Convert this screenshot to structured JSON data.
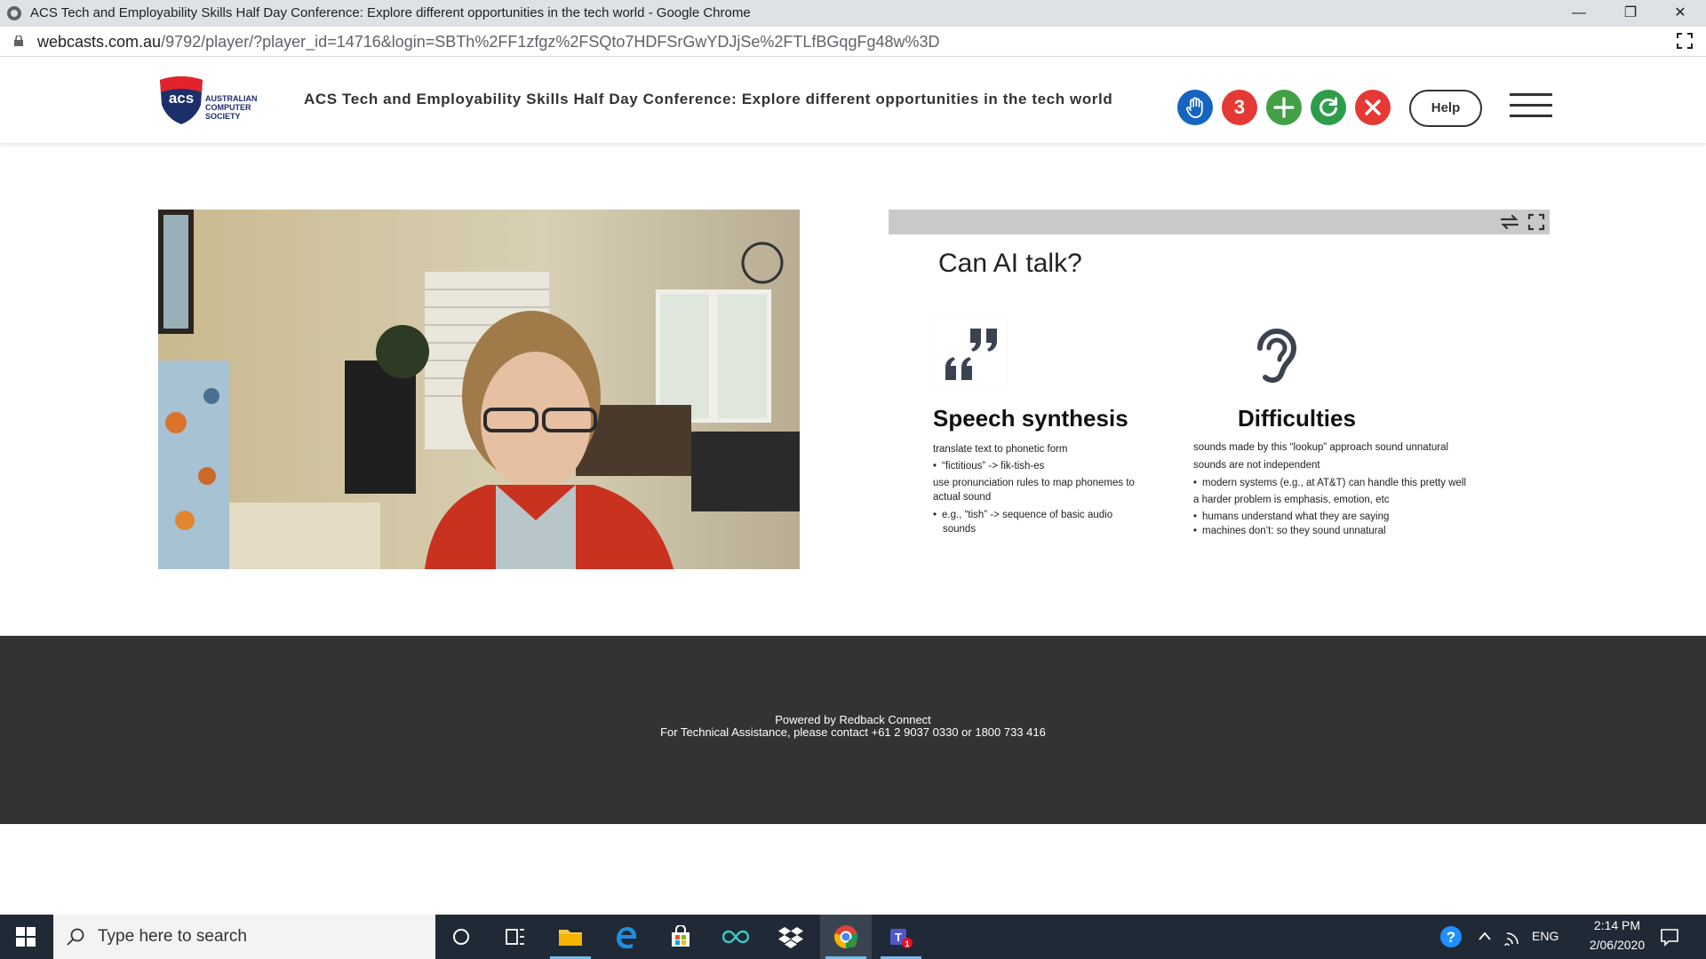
{
  "window": {
    "title": "ACS Tech and Employability Skills Half Day Conference: Explore different opportunities in the tech world - Google Chrome",
    "controls": {
      "minimize": "—",
      "restore": "❐",
      "close": "✕"
    }
  },
  "address_bar": {
    "host": "webcasts.com.au",
    "path": "/9792/player/?player_id=14716&login=SBTh%2FF1zfgz%2FSQto7HDFSrGwYDJjSe%2FTLfBGqgFg48w%3D"
  },
  "header": {
    "logo": {
      "mark": "acs",
      "line1": "AUSTRALIAN",
      "line2": "COMPUTER",
      "line3": "SOCIETY"
    },
    "conference_title": "ACS Tech and Employability Skills Half Day Conference: Explore different opportunities in the tech world",
    "buttons": {
      "raise_hand": {
        "icon": "hand-icon",
        "color": "#1565c0"
      },
      "count": {
        "label": "3",
        "color": "#e53935"
      },
      "add": {
        "icon": "plus-icon",
        "color": "#43a047"
      },
      "refresh": {
        "icon": "refresh-icon",
        "color": "#2e9d4a"
      },
      "close": {
        "icon": "close-icon",
        "color": "#e53935"
      }
    },
    "help_label": "Help"
  },
  "slide": {
    "title": "Can AI talk?",
    "left": {
      "heading": "Speech synthesis",
      "lines": [
        {
          "text": "translate text to phonetic form",
          "bullet": false
        },
        {
          "text": "“fictitious” -> fik-tish-es",
          "bullet": true
        },
        {
          "text": "use pronunciation rules to map phonemes to",
          "bullet": false
        },
        {
          "text": "actual sound",
          "bullet": false
        },
        {
          "text": "e.g., “tish” -> sequence of basic audio",
          "bullet": true
        },
        {
          "text": "sounds",
          "bullet": false
        }
      ]
    },
    "right": {
      "heading": "Difficulties",
      "lines": [
        {
          "text": "sounds made by this “lookup” approach sound unnatural",
          "bullet": false
        },
        {
          "text": "sounds are not independent",
          "bullet": false
        },
        {
          "text": "modern systems (e.g., at AT&T) can handle this pretty well",
          "bullet": true
        },
        {
          "text": "a harder problem is emphasis, emotion, etc",
          "bullet": false
        },
        {
          "text": "humans understand what they are saying",
          "bullet": true
        },
        {
          "text": "machines don’t: so they sound unnatural",
          "bullet": true
        }
      ]
    }
  },
  "footer": {
    "line1": "Powered by Redback Connect",
    "line2": "For Technical Assistance, please contact +61 2 9037 0330 or 1800 733 416"
  },
  "taskbar": {
    "search_placeholder": "Type here to search",
    "tray": {
      "language": "ENG",
      "time": "2:14 PM",
      "date": "2/06/2020"
    },
    "teams_badge": "1"
  }
}
